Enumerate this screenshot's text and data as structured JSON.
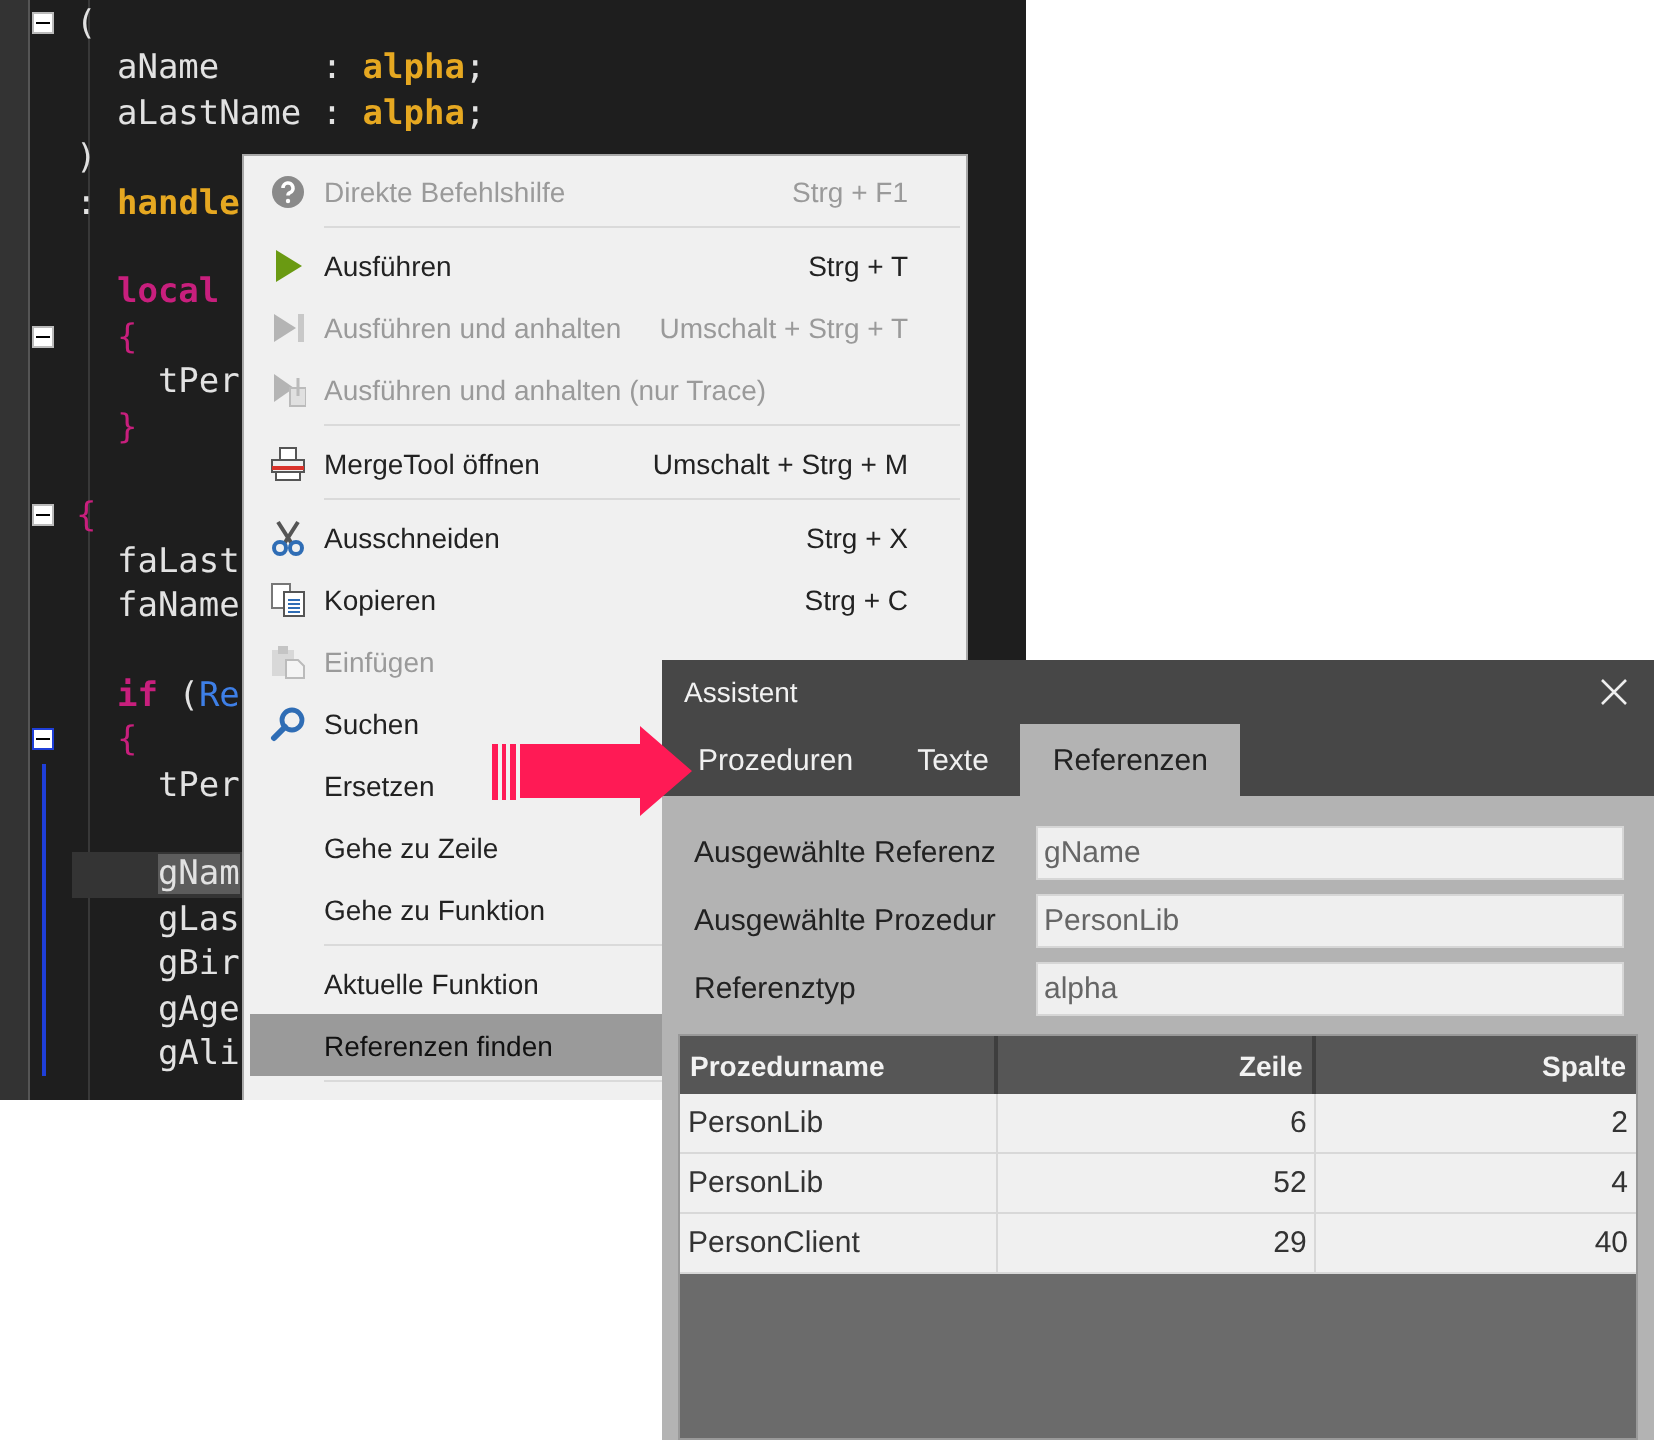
{
  "editor": {
    "lines": [
      {
        "fold": {
          "focused": false
        },
        "current": false,
        "tokens": [
          {
            "text": "(",
            "kind": "plain"
          }
        ]
      },
      {
        "current": false,
        "tokens": [
          {
            "text": "  aName     : ",
            "kind": "plain"
          },
          {
            "text": "alpha",
            "kind": "type"
          },
          {
            "text": ";",
            "kind": "plain"
          }
        ]
      },
      {
        "current": false,
        "tokens": [
          {
            "text": "  aLastName : ",
            "kind": "plain"
          },
          {
            "text": "alpha",
            "kind": "type"
          },
          {
            "text": ";",
            "kind": "plain"
          }
        ]
      },
      {
        "current": false,
        "tokens": [
          {
            "text": ")",
            "kind": "plain"
          }
        ]
      },
      {
        "current": false,
        "tokens": [
          {
            "text": ": ",
            "kind": "plain"
          },
          {
            "text": "handle",
            "kind": "type"
          }
        ]
      },
      {
        "current": false
      },
      {
        "current": false,
        "tokens": [
          {
            "text": "  local",
            "kind": "keyword"
          }
        ]
      },
      {
        "fold": {
          "focused": false
        },
        "current": false,
        "tokens": [
          {
            "text": "  {",
            "kind": "brace"
          }
        ]
      },
      {
        "current": false,
        "tokens": [
          {
            "text": "    tPer",
            "kind": "plain"
          }
        ]
      },
      {
        "current": false,
        "tokens": [
          {
            "text": "  }",
            "kind": "brace"
          }
        ]
      },
      {
        "current": false
      },
      {
        "fold": {
          "focused": false
        },
        "current": false,
        "tokens": [
          {
            "text": "{",
            "kind": "brace"
          }
        ]
      },
      {
        "current": false,
        "tokens": [
          {
            "text": "  faLast",
            "kind": "plain"
          }
        ]
      },
      {
        "current": false,
        "tokens": [
          {
            "text": "  faName",
            "kind": "plain"
          }
        ]
      },
      {
        "current": false
      },
      {
        "current": false,
        "tokens": [
          {
            "text": "  if",
            "kind": "keyword"
          },
          {
            "text": " (",
            "kind": "plain"
          },
          {
            "text": "Re",
            "kind": "name"
          }
        ]
      },
      {
        "fold": {
          "focused": true
        },
        "current": false,
        "tokens": [
          {
            "text": "  {",
            "kind": "brace"
          }
        ]
      },
      {
        "current": false,
        "tokens": [
          {
            "text": "    tPer",
            "kind": "plain"
          }
        ]
      },
      {
        "current": false
      },
      {
        "current": true,
        "tokens": [
          {
            "text": "    gNam",
            "kind": "selection"
          }
        ]
      },
      {
        "current": false,
        "tokens": [
          {
            "text": "    gLas",
            "kind": "plain"
          }
        ]
      },
      {
        "current": false,
        "tokens": [
          {
            "text": "    gBir",
            "kind": "plain"
          }
        ]
      },
      {
        "current": false,
        "tokens": [
          {
            "text": "    gAge",
            "kind": "plain"
          }
        ]
      },
      {
        "current": false,
        "tokens": [
          {
            "text": "    gAli",
            "kind": "plain"
          }
        ]
      }
    ]
  },
  "context_menu": {
    "items": [
      {
        "kind": "help",
        "label": "Direkte Befehlshilfe",
        "shortcut": "Strg + F1",
        "disabled": true,
        "highlighted": false
      },
      {
        "kind": "separator"
      },
      {
        "kind": "run",
        "label": "Ausführen",
        "shortcut": "Strg + T",
        "disabled": false,
        "highlighted": false
      },
      {
        "kind": "run-break",
        "label": "Ausführen und anhalten",
        "shortcut": "Umschalt + Strg + T",
        "disabled": true,
        "highlighted": false
      },
      {
        "kind": "run-trace",
        "label": "Ausführen und anhalten (nur Trace)",
        "disabled": true,
        "highlighted": false
      },
      {
        "kind": "separator"
      },
      {
        "kind": "merge",
        "label": "MergeTool öffnen",
        "shortcut": "Umschalt + Strg + M",
        "disabled": false,
        "highlighted": false
      },
      {
        "kind": "separator"
      },
      {
        "kind": "cut",
        "label": "Ausschneiden",
        "shortcut": "Strg + X",
        "disabled": false,
        "highlighted": false
      },
      {
        "kind": "copy",
        "label": "Kopieren",
        "shortcut": "Strg + C",
        "disabled": false,
        "highlighted": false
      },
      {
        "kind": "paste",
        "label": "Einfügen",
        "disabled": true,
        "highlighted": false
      },
      {
        "kind": "search",
        "label": "Suchen",
        "disabled": false,
        "highlighted": false
      },
      {
        "kind": "plain",
        "label": "Ersetzen",
        "disabled": false,
        "highlighted": false
      },
      {
        "kind": "plain",
        "label": "Gehe zu Zeile",
        "disabled": false,
        "highlighted": false
      },
      {
        "kind": "plain",
        "label": "Gehe zu Funktion",
        "disabled": false,
        "highlighted": false
      },
      {
        "kind": "separator"
      },
      {
        "kind": "plain",
        "label": "Aktuelle Funktion",
        "disabled": false,
        "highlighted": false
      },
      {
        "kind": "plain",
        "label": "Referenzen finden",
        "disabled": false,
        "highlighted": true
      },
      {
        "kind": "separator"
      }
    ]
  },
  "dialog": {
    "title": "Assistent",
    "tabs": [
      {
        "label": "Prozeduren",
        "selected": false
      },
      {
        "label": "Texte",
        "selected": false
      },
      {
        "label": "Referenzen",
        "selected": true
      }
    ],
    "fields": [
      {
        "label": "Ausgewählte Referenz",
        "value": "gName"
      },
      {
        "label": "Ausgewählte Prozedur",
        "value": "PersonLib"
      },
      {
        "label": "Referenztyp",
        "value": "alpha"
      }
    ],
    "table": {
      "columns": [
        "Prozedurname",
        "Zeile",
        "Spalte"
      ],
      "rows": [
        {
          "cells": [
            "PersonLib",
            "6",
            "2"
          ]
        },
        {
          "cells": [
            "PersonLib",
            "52",
            "4"
          ]
        },
        {
          "cells": [
            "PersonClient",
            "29",
            "40"
          ]
        }
      ]
    }
  }
}
